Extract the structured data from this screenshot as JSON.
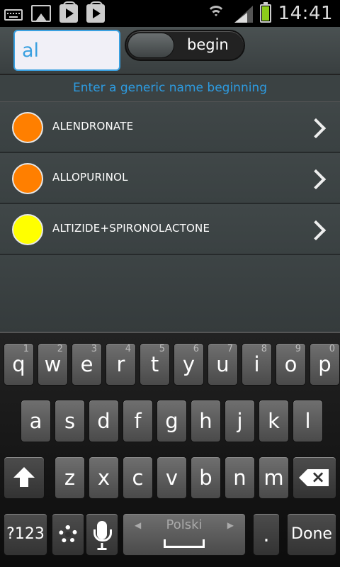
{
  "status_bar": {
    "time": "14:41",
    "icons": [
      "keyboard-icon",
      "image-icon",
      "play-store-icon",
      "play-store-icon",
      "wifi-icon",
      "signal-icon",
      "battery-icon"
    ]
  },
  "search": {
    "value": "al",
    "mode_label": "begin"
  },
  "hint": "Enter a generic name beginning",
  "results": [
    {
      "name": "ALENDRONATE",
      "color": "#ff7f00"
    },
    {
      "name": "ALLOPURINOL",
      "color": "#ff7f00"
    },
    {
      "name": "ALTIZIDE+SPIRONOLACTONE",
      "color": "#ffff00"
    }
  ],
  "keyboard": {
    "row1": [
      {
        "k": "q",
        "n": "1"
      },
      {
        "k": "w",
        "n": "2"
      },
      {
        "k": "e",
        "n": "3"
      },
      {
        "k": "r",
        "n": "4"
      },
      {
        "k": "t",
        "n": "5"
      },
      {
        "k": "y",
        "n": "6"
      },
      {
        "k": "u",
        "n": "7"
      },
      {
        "k": "i",
        "n": "8"
      },
      {
        "k": "o",
        "n": "9"
      },
      {
        "k": "p",
        "n": "0"
      }
    ],
    "row2": [
      "a",
      "s",
      "d",
      "f",
      "g",
      "h",
      "j",
      "k",
      "l"
    ],
    "row3": [
      "z",
      "x",
      "c",
      "v",
      "b",
      "n",
      "m"
    ],
    "symbols_label": "?123",
    "language_label": "Polski",
    "period_label": ".",
    "done_label": "Done"
  }
}
